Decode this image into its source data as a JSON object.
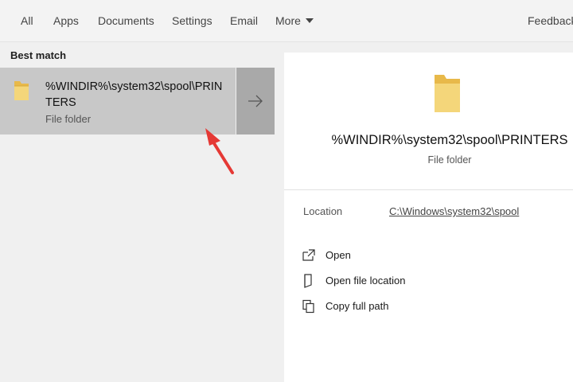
{
  "topbar": {
    "tabs": [
      {
        "label": "All"
      },
      {
        "label": "Apps"
      },
      {
        "label": "Documents"
      },
      {
        "label": "Settings"
      },
      {
        "label": "Email"
      },
      {
        "label": "More"
      }
    ],
    "feedback_label": "Feedback"
  },
  "left": {
    "section_label": "Best match",
    "result": {
      "title": "%WINDIR%\\system32\\spool\\PRINTERS",
      "subtitle": "File folder",
      "icon": "folder-icon",
      "arrow_icon": "arrow-right-icon"
    }
  },
  "preview": {
    "icon": "folder-icon",
    "title": "%WINDIR%\\system32\\spool\\PRINTERS",
    "subtitle": "File folder",
    "location_label": "Location",
    "location_value": "C:\\Windows\\system32\\spool",
    "actions": [
      {
        "label": "Open",
        "icon": "open-icon"
      },
      {
        "label": "Open file location",
        "icon": "file-location-icon"
      },
      {
        "label": "Copy full path",
        "icon": "copy-icon"
      }
    ]
  },
  "colors": {
    "selected_result": "#c8c8c8",
    "arrow_button": "#a9a9a9",
    "annotation_arrow": "#e53935",
    "folder_yellow": "#f4d67a"
  }
}
